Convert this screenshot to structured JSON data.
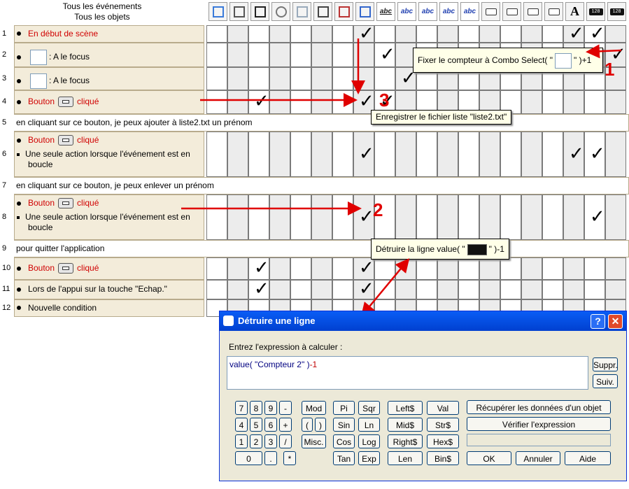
{
  "header": {
    "events_title": "Tous les événements",
    "objects_title": "Tous les objets",
    "toolbar_icons": [
      {
        "name": "application-icon"
      },
      {
        "name": "sound-icon"
      },
      {
        "name": "chess-board-icon"
      },
      {
        "name": "timer-icon"
      },
      {
        "name": "create-object-icon"
      },
      {
        "name": "keyboard-icon"
      },
      {
        "name": "mouse-pointer-icon"
      },
      {
        "name": "combo-select-icon"
      },
      {
        "name": "text-abc-underlined-icon",
        "text": "abc"
      },
      {
        "name": "text-abc-icon",
        "text": "abc"
      },
      {
        "name": "text-abc-icon",
        "text": "abc"
      },
      {
        "name": "text-abc-icon",
        "text": "abc"
      },
      {
        "name": "text-abc-icon",
        "text": "abc"
      },
      {
        "name": "button-object-icon"
      },
      {
        "name": "button-object-icon"
      },
      {
        "name": "button-object-icon"
      },
      {
        "name": "button-object-icon"
      },
      {
        "name": "string-object-icon",
        "text": "A"
      },
      {
        "name": "counter-icon",
        "text": "128"
      },
      {
        "name": "counter-icon",
        "text": "128"
      }
    ]
  },
  "rows": [
    {
      "num": "1",
      "lines": [
        {
          "kind": "bullet",
          "text": "En début de scène",
          "red": true
        }
      ]
    },
    {
      "num": "2",
      "lines": [
        {
          "kind": "combo",
          "text": ": A le focus"
        }
      ]
    },
    {
      "num": "3",
      "lines": [
        {
          "kind": "combo",
          "text": ": A le focus"
        }
      ]
    },
    {
      "num": "4",
      "lines": [
        {
          "kind": "button",
          "pre": "Bouton",
          "post": "cliqué"
        }
      ]
    },
    {
      "num": "5",
      "comment": "en cliquant sur ce bouton, je peux ajouter à  liste2.txt un prénom"
    },
    {
      "num": "6",
      "lines": [
        {
          "kind": "button",
          "pre": "Bouton",
          "post": "cliqué"
        },
        {
          "kind": "sub",
          "text": "Une seule action lorsque l'événement est en"
        },
        {
          "kind": "cont",
          "text": "boucle"
        }
      ]
    },
    {
      "num": "7",
      "comment": "en cliquant sur ce bouton, je peux enlever un prénom"
    },
    {
      "num": "8",
      "lines": [
        {
          "kind": "button",
          "pre": "Bouton",
          "post": "cliqué"
        },
        {
          "kind": "sub",
          "text": "Une seule action lorsque l'événement est en"
        },
        {
          "kind": "cont",
          "text": "boucle"
        }
      ]
    },
    {
      "num": "9",
      "comment": "pour quitter l'application"
    },
    {
      "num": "10",
      "lines": [
        {
          "kind": "button",
          "pre": "Bouton",
          "post": "cliqué"
        }
      ]
    },
    {
      "num": "11",
      "lines": [
        {
          "kind": "bullet",
          "text": "Lors de l'appui sur la touche \"Echap.\""
        }
      ]
    },
    {
      "num": "12",
      "lines": [
        {
          "kind": "bullet",
          "text": "Nouvelle condition"
        }
      ]
    }
  ],
  "check_glyph": "✓",
  "tooltips": {
    "counter_pre": "Fixer le compteur à Combo Select( \"",
    "counter_post": "\" )+1",
    "save_file": "Enregistrer le fichier liste \"liste2.txt\"",
    "delete_pre": "Détruire la ligne value( \"",
    "delete_post": "\" )-1"
  },
  "annotations": {
    "n1": "1",
    "n2": "2",
    "n3": "3"
  },
  "dialog": {
    "title": "Détruire une ligne",
    "help_btn": "?",
    "close_btn": "✕",
    "prompt": "Entrez l'expression à calculer :",
    "expr_pre": "value( \"Compteur 2\" )",
    "expr_post": "-1",
    "suppr": "Suppr.",
    "suiv": "Suiv.",
    "keys_digits": [
      [
        "7",
        "8",
        "9",
        "-"
      ],
      [
        "4",
        "5",
        "6",
        "+"
      ],
      [
        "1",
        "2",
        "3",
        "/"
      ]
    ],
    "key_paren_open": "(",
    "key_paren_close": ")",
    "key_zero": "0",
    "key_dot": ".",
    "key_star": "*",
    "key_mod": "Mod",
    "key_misc": "Misc.",
    "funcs": [
      [
        "Pi",
        "Sqr"
      ],
      [
        "Sin",
        "Ln"
      ],
      [
        "Cos",
        "Log"
      ],
      [
        "Tan",
        "Exp"
      ]
    ],
    "funcs2": [
      [
        "Left$",
        "Val"
      ],
      [
        "Mid$",
        "Str$"
      ],
      [
        "Right$",
        "Hex$"
      ],
      [
        "Len",
        "Bin$"
      ]
    ],
    "get_data": "Récupérer les données d'un objet",
    "verify": "Vérifier l'expression",
    "ok": "OK",
    "cancel": "Annuler",
    "help": "Aide"
  }
}
